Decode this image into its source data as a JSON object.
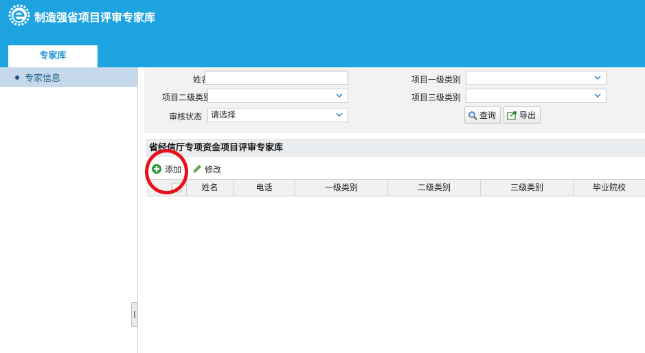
{
  "header": {
    "app_title": "制造强省项目评审专家库",
    "tab_label": "专家库",
    "colors": {
      "brand": "#1ea3e1",
      "annotation": "#e8101c"
    }
  },
  "sidebar": {
    "items": [
      {
        "label": "专家信息",
        "icon": "bullet-dot"
      }
    ]
  },
  "search": {
    "name_label": "姓名",
    "name_value": "",
    "level1_label": "项目一级类别",
    "level1_value": "",
    "level2_label": "项目二级类别",
    "level2_value": "",
    "level3_label": "项目三级类别",
    "level3_value": "",
    "status_label": "审核状态",
    "status_value": "请选择",
    "query_label": "查询",
    "export_label": "导出"
  },
  "grid": {
    "title": "省经信厅专项资金项目评审专家库",
    "add_label": "添加",
    "edit_label": "修改",
    "columns": [
      "姓名",
      "电话",
      "一级类别",
      "二级类别",
      "三级类别",
      "毕业院校"
    ]
  }
}
